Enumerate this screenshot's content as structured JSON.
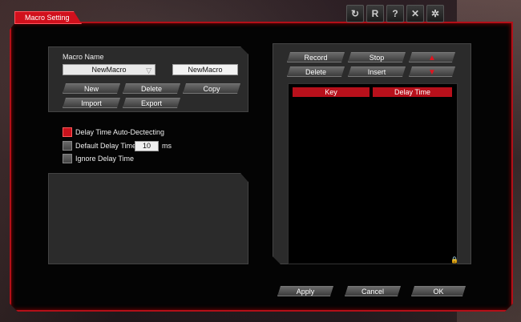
{
  "window": {
    "title": "Macro Setting"
  },
  "top_icons": [
    {
      "name": "refresh-icon",
      "glyph": "↻"
    },
    {
      "name": "r-icon",
      "glyph": "R"
    },
    {
      "name": "help-icon",
      "glyph": "?"
    },
    {
      "name": "close-icon",
      "glyph": "✕"
    },
    {
      "name": "tools-icon",
      "glyph": "✲"
    }
  ],
  "macro": {
    "name_label": "Macro Name",
    "selected": "NewMacro",
    "name_value": "NewMacro",
    "buttons": {
      "new": "New",
      "delete": "Delete",
      "copy": "Copy",
      "import": "Import",
      "export": "Export"
    }
  },
  "options": {
    "auto_detect_label": "Delay Time Auto-Dectecting",
    "auto_detect_checked": true,
    "default_delay_label": "Default Delay Time",
    "default_delay_value": "10",
    "default_delay_unit": "ms",
    "ignore_delay_label": "Ignore Delay Time"
  },
  "recorder": {
    "record": "Record",
    "stop": "Stop",
    "delete": "Delete",
    "insert": "Insert",
    "columns": [
      "Key",
      "Delay Time"
    ]
  },
  "footer": {
    "apply": "Apply",
    "cancel": "Cancel",
    "ok": "OK"
  },
  "colors": {
    "accent": "#d1101c",
    "panel": "#2b2b2b",
    "background": "#040404"
  }
}
